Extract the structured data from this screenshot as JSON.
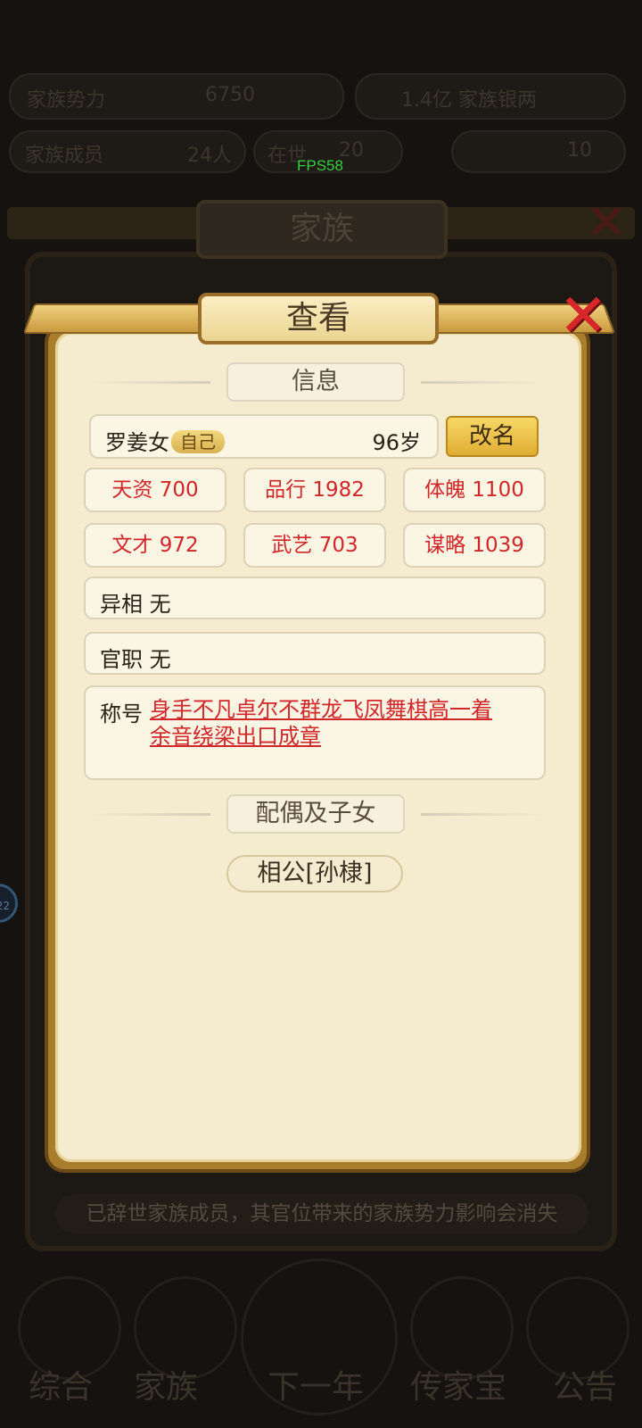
{
  "fps": "FPS58",
  "background": {
    "topbar": [
      "家族势力",
      "6750",
      "1.4亿 家族银两"
    ],
    "secondbar": [
      "家族成员",
      "24人",
      "在世",
      "20",
      "10"
    ],
    "panel_title": "家族",
    "footer_note": "已辞世家族成员，其官位带来的家族势力影响会消失",
    "bottom_nav": [
      "综合",
      "家族",
      "下一年",
      "传家宝",
      "公告"
    ]
  },
  "popup": {
    "title": "查看",
    "close_icon": "close-x-icon",
    "info_header": "信息",
    "member": {
      "name": "罗姜女",
      "tag": "自己",
      "age": "96岁",
      "rename_label": "改名"
    },
    "stats": [
      {
        "label": "天资 700"
      },
      {
        "label": "品行 1982"
      },
      {
        "label": "体魄 1100"
      },
      {
        "label": "文才 972"
      },
      {
        "label": "武艺 703"
      },
      {
        "label": "谋略 1039"
      }
    ],
    "yixiang": "异相 无",
    "guanzhi": "官职 无",
    "chenghao_label": "称号",
    "chenghao_line1": "身手不凡卓尔不群龙飞凤舞棋高一着",
    "chenghao_line2": "余音绕梁出口成章",
    "spouse_header": "配偶及子女",
    "spouse_button": "相公[孙棣]"
  },
  "colors": {
    "accent_red": "#d1262a",
    "panel_bg": "#f5ecd0",
    "gold": "#e0ae34"
  }
}
